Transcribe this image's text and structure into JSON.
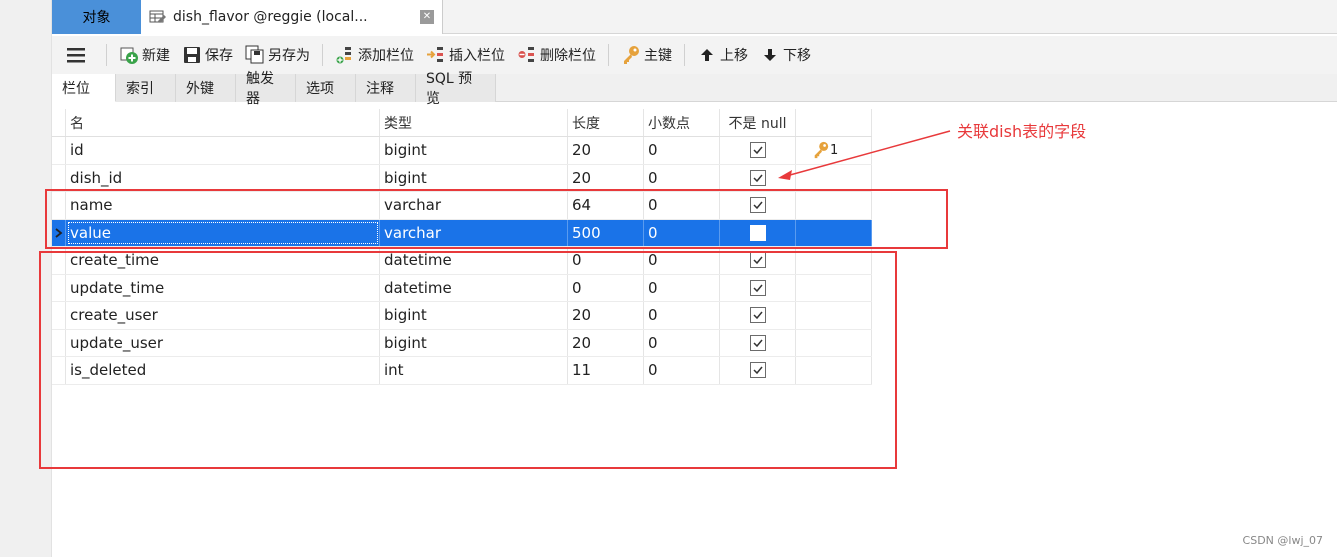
{
  "tabs": {
    "objects": "对象",
    "table": "dish_flavor @reggie (local..."
  },
  "toolbar": {
    "new": "新建",
    "save": "保存",
    "save_as": "另存为",
    "add_field": "添加栏位",
    "insert_field": "插入栏位",
    "delete_field": "删除栏位",
    "primary_key": "主键",
    "move_up": "上移",
    "move_down": "下移"
  },
  "subtabs": [
    "栏位",
    "索引",
    "外键",
    "触发器",
    "选项",
    "注释",
    "SQL 预览"
  ],
  "grid": {
    "headers": {
      "name": "名",
      "type": "类型",
      "length": "长度",
      "decimals": "小数点",
      "not_null": "不是 null"
    },
    "rows": [
      {
        "name": "id",
        "type": "bigint",
        "length": "20",
        "decimals": "0",
        "not_null": true,
        "key": "1"
      },
      {
        "name": "dish_id",
        "type": "bigint",
        "length": "20",
        "decimals": "0",
        "not_null": true,
        "key": ""
      },
      {
        "name": "name",
        "type": "varchar",
        "length": "64",
        "decimals": "0",
        "not_null": true,
        "key": ""
      },
      {
        "name": "value",
        "type": "varchar",
        "length": "500",
        "decimals": "0",
        "not_null": false,
        "key": "",
        "selected": true
      },
      {
        "name": "create_time",
        "type": "datetime",
        "length": "0",
        "decimals": "0",
        "not_null": true,
        "key": ""
      },
      {
        "name": "update_time",
        "type": "datetime",
        "length": "0",
        "decimals": "0",
        "not_null": true,
        "key": ""
      },
      {
        "name": "create_user",
        "type": "bigint",
        "length": "20",
        "decimals": "0",
        "not_null": true,
        "key": ""
      },
      {
        "name": "update_user",
        "type": "bigint",
        "length": "20",
        "decimals": "0",
        "not_null": true,
        "key": ""
      },
      {
        "name": "is_deleted",
        "type": "int",
        "length": "11",
        "decimals": "0",
        "not_null": true,
        "key": ""
      }
    ]
  },
  "annotation": {
    "text": "关联dish表的字段",
    "color": "#e8393b"
  },
  "watermark": "CSDN @lwj_07"
}
